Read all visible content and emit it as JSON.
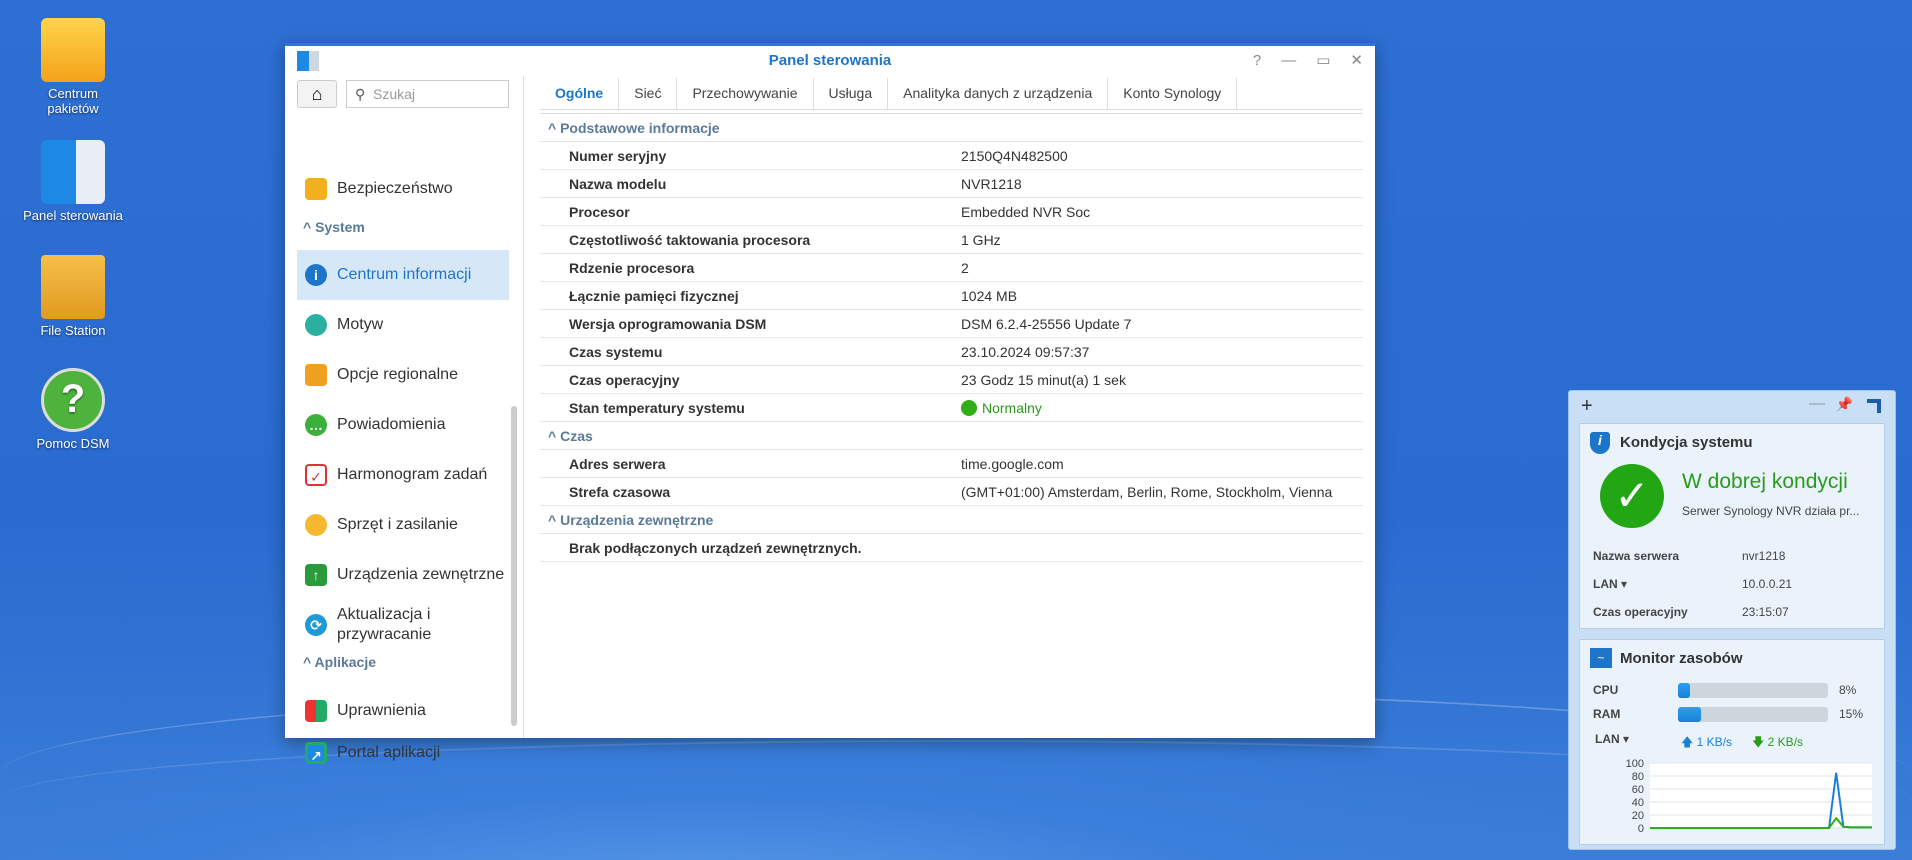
{
  "desktop": {
    "icons": [
      {
        "label": "Centrum pakietów"
      },
      {
        "label": "Panel sterowania"
      },
      {
        "label": "File Station"
      },
      {
        "label": "Pomoc DSM"
      }
    ]
  },
  "window": {
    "title": "Panel sterowania",
    "search_placeholder": "Szukaj",
    "sidebar": {
      "top_item": "Bezpieczeństwo",
      "system_header": "System",
      "system_items": [
        "Centrum informacji",
        "Motyw",
        "Opcje regionalne",
        "Powiadomienia",
        "Harmonogram zadań",
        "Sprzęt i zasilanie",
        "Urządzenia zewnętrzne",
        "Aktualizacja i przywracanie"
      ],
      "apps_header": "Aplikacje",
      "app_items": [
        "Uprawnienia",
        "Portal aplikacji"
      ]
    },
    "tabs": [
      "Ogólne",
      "Sieć",
      "Przechowywanie",
      "Usługa",
      "Analityka danych z urządzenia",
      "Konto Synology"
    ],
    "sections": {
      "basic": {
        "title": "Podstawowe informacje",
        "rows": [
          [
            "Numer seryjny",
            "2150Q4N482500"
          ],
          [
            "Nazwa modelu",
            "NVR1218"
          ],
          [
            "Procesor",
            "Embedded NVR Soc"
          ],
          [
            "Częstotliwość taktowania procesora",
            "1 GHz"
          ],
          [
            "Rdzenie procesora",
            "2"
          ],
          [
            "Łącznie pamięci fizycznej",
            "1024 MB"
          ],
          [
            "Wersja oprogramowania DSM",
            "DSM 6.2.4-25556 Update 7"
          ],
          [
            "Czas systemu",
            "23.10.2024 09:57:37"
          ],
          [
            "Czas operacyjny",
            "23 Godz 15 minut(a) 1 sek"
          ],
          [
            "Stan temperatury systemu",
            "Normalny"
          ]
        ]
      },
      "time": {
        "title": "Czas",
        "rows": [
          [
            "Adres serwera",
            "time.google.com"
          ],
          [
            "Strefa czasowa",
            "(GMT+01:00) Amsterdam, Berlin, Rome, Stockholm, Vienna"
          ]
        ]
      },
      "external": {
        "title": "Urządzenia zewnętrzne",
        "message": "Brak podłączonych urządzeń zewnętrznych."
      }
    }
  },
  "widget": {
    "health": {
      "title": "Kondycja systemu",
      "status": "W dobrej kondycji",
      "desc": "Serwer Synology NVR działa pr...",
      "server_label": "Nazwa serwera",
      "server": "nvr1218",
      "lan_label": "LAN",
      "lan": "10.0.0.21",
      "uptime_label": "Czas operacyjny",
      "uptime": "23:15:07"
    },
    "monitor": {
      "title": "Monitor zasobów",
      "cpu_label": "CPU",
      "cpu": 8,
      "cpu_text": "8%",
      "ram_label": "RAM",
      "ram": 15,
      "ram_text": "15%",
      "lan_label": "LAN",
      "up": "1 KB/s",
      "down": "2 KB/s"
    }
  },
  "chart_data": {
    "type": "line",
    "yticks": [
      "100",
      "80",
      "60",
      "40",
      "20",
      "0"
    ],
    "ylim": [
      0,
      100
    ],
    "series": [
      {
        "name": "upload",
        "color": "#1a7fd8",
        "values": [
          0,
          0,
          0,
          0,
          0,
          0,
          0,
          0,
          0,
          0,
          0,
          0,
          0,
          0,
          0,
          0,
          0,
          0,
          0,
          0,
          0,
          0,
          0,
          0,
          0,
          0,
          85,
          2,
          1,
          1,
          1,
          1
        ]
      },
      {
        "name": "download",
        "color": "#2fae18",
        "values": [
          0,
          0,
          0,
          0,
          0,
          0,
          0,
          0,
          0,
          0,
          0,
          0,
          0,
          0,
          0,
          0,
          0,
          0,
          0,
          0,
          0,
          0,
          0,
          0,
          0,
          0,
          15,
          2,
          1,
          1,
          1,
          1
        ]
      }
    ]
  }
}
